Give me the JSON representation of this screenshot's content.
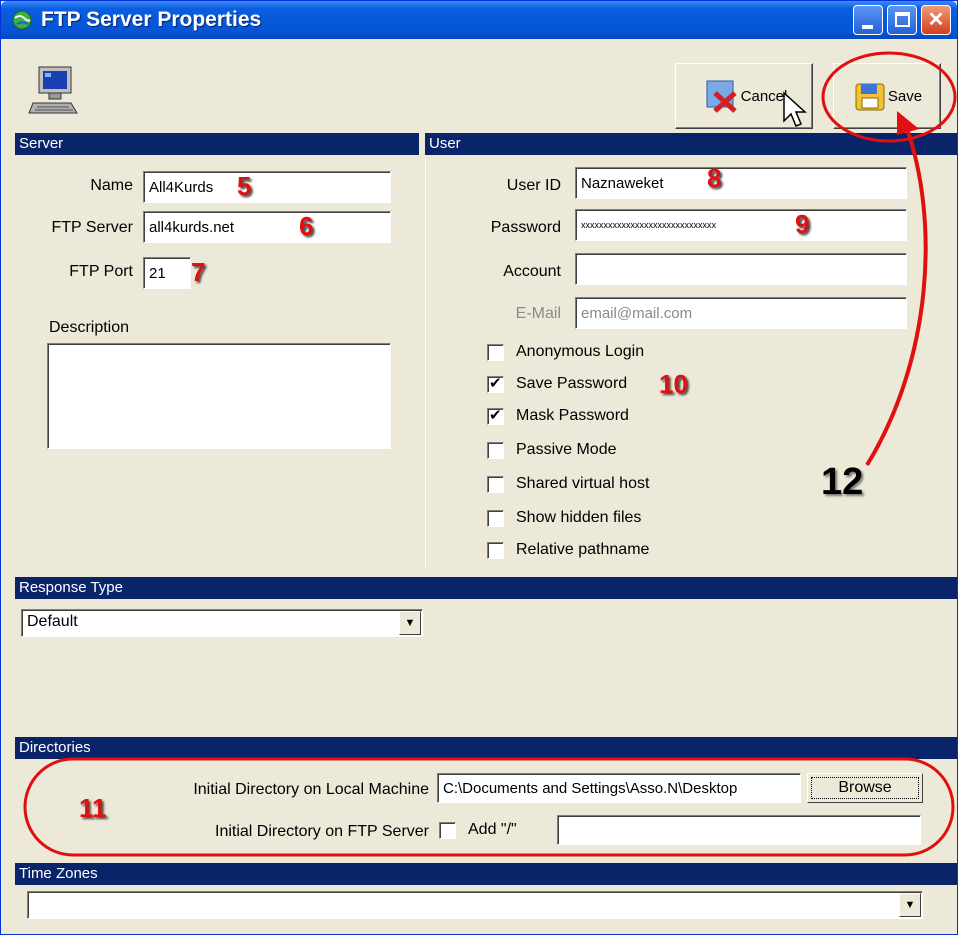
{
  "window": {
    "title": "FTP Server Properties"
  },
  "toolbar": {
    "cancel_label": "Cancel",
    "save_label": "Save"
  },
  "server": {
    "header": "Server",
    "name_label": "Name",
    "name_value": "All4Kurds",
    "ftp_server_label": "FTP Server",
    "ftp_server_value": "all4kurds.net",
    "port_label": "FTP Port",
    "port_value": "21",
    "description_label": "Description",
    "description_value": ""
  },
  "user": {
    "header": "User",
    "user_id_label": "User ID",
    "user_id_value": "Naznaweket",
    "password_label": "Password",
    "password_value": "xxxxxxxxxxxxxxxxxxxxxxxxxxxxxx",
    "account_label": "Account",
    "account_value": "",
    "email_label": "E-Mail",
    "email_value": "email@mail.com",
    "options": [
      {
        "label": "Anonymous Login",
        "checked": false
      },
      {
        "label": "Save Password",
        "checked": true
      },
      {
        "label": "Mask Password",
        "checked": true
      },
      {
        "label": "Passive Mode",
        "checked": false
      },
      {
        "label": "Shared virtual host",
        "checked": false
      },
      {
        "label": "Show hidden files",
        "checked": false
      },
      {
        "label": "Relative pathname",
        "checked": false
      }
    ]
  },
  "response": {
    "header": "Response Type",
    "selected": "Default"
  },
  "directories": {
    "header": "Directories",
    "local_label": "Initial Directory on Local Machine",
    "local_value": "C:\\Documents and Settings\\Asso.N\\Desktop",
    "browse_label": "Browse",
    "ftp_label": "Initial Directory on FTP Server",
    "add_slash_label": "Add \"/\"",
    "ftp_value": ""
  },
  "timezones": {
    "header": "Time Zones",
    "selected": ""
  },
  "annotations": {
    "a5": "5",
    "a6": "6",
    "a7": "7",
    "a8": "8",
    "a9": "9",
    "a10": "10",
    "a11": "11",
    "a12": "12"
  },
  "colors": {
    "titlebar": "#0a5ee0",
    "section_header": "#0a246a",
    "annotation": "#e01010",
    "window_bg": "#ece9d8"
  },
  "icons": [
    "app-globe-icon",
    "computer-icon",
    "cancel-icon",
    "save-icon",
    "cursor-icon"
  ]
}
